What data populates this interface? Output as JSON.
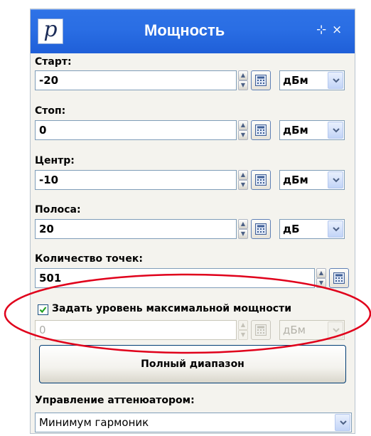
{
  "window": {
    "title": "Мощность",
    "logo_letter": "p",
    "pin_glyph": "⊹",
    "close_glyph": "×"
  },
  "fields": [
    {
      "label": "Старт:",
      "value": "-20",
      "unit": "дБм"
    },
    {
      "label": "Стоп:",
      "value": "0",
      "unit": "дБм"
    },
    {
      "label": "Центр:",
      "value": "-10",
      "unit": "дБм"
    },
    {
      "label": "Полоса:",
      "value": "20",
      "unit": "дБ"
    }
  ],
  "points": {
    "label": "Количество точек:",
    "value": "501"
  },
  "max_power": {
    "checkbox_label": "Задать уровень максимальной мощности",
    "checked": true,
    "value": "0",
    "unit": "дБм",
    "enabled": false
  },
  "full_range_button": "Полный диапазон",
  "attenuator": {
    "label": "Управление аттенюатором:",
    "value": "Минимум гармоник"
  },
  "icons": {
    "spin": "spin-updown-icon",
    "calculator": "calculator-icon",
    "dropdown": "chevron-down-icon",
    "check": "check-icon"
  },
  "colors": {
    "titlebar": "#2a6ee4",
    "panel_bg": "#f4f3ee",
    "highlight_ellipse": "#e0001b",
    "checkbox_check": "#21a121"
  }
}
